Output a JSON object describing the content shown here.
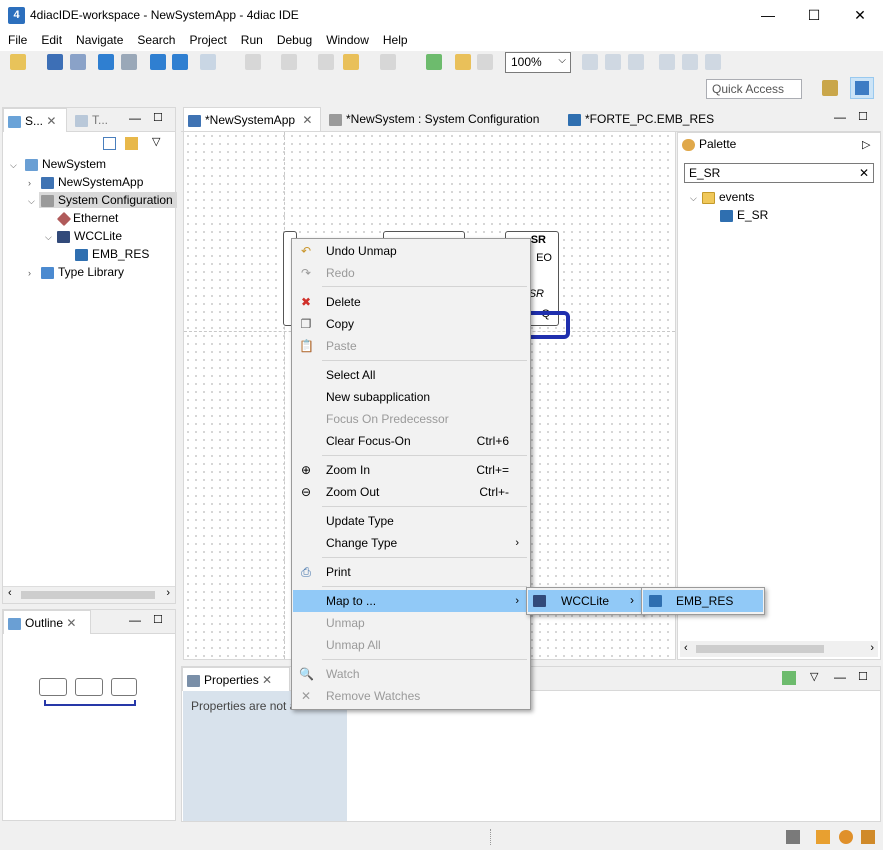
{
  "window": {
    "title": "4diacIDE-workspace - NewSystemApp - 4diac IDE",
    "minimize": "—",
    "maximize": "☐",
    "close": "✕"
  },
  "menu": [
    "File",
    "Edit",
    "Navigate",
    "Search",
    "Project",
    "Run",
    "Debug",
    "Window",
    "Help"
  ],
  "toolbar": {
    "zoom": "100%",
    "quick_access": "Quick Access"
  },
  "system_view": {
    "tabs": [
      "S...",
      "T..."
    ],
    "tree": [
      {
        "label": "NewSystem",
        "level": 0
      },
      {
        "label": "NewSystemApp",
        "level": 1
      },
      {
        "label": "System Configuration",
        "level": 1
      },
      {
        "label": "Ethernet",
        "level": 2
      },
      {
        "label": "WCCLite",
        "level": 2
      },
      {
        "label": "EMB_RES",
        "level": 3
      },
      {
        "label": "Type Library",
        "level": 1
      }
    ]
  },
  "outline": {
    "title": "Outline"
  },
  "editor": {
    "tabs": [
      "*NewSystemApp",
      "*NewSystem : System Configuration",
      "*FORTE_PC.EMB_RES"
    ],
    "fb_labels": {
      "title": "SR",
      "eo": "EO",
      "sr": "SR",
      "q": "Q"
    }
  },
  "palette": {
    "title": "Palette",
    "search": "E_SR",
    "clear": "✕",
    "folder": "events",
    "item": "E_SR"
  },
  "properties": {
    "title": "Properties",
    "text": "Properties are not a"
  },
  "context_menu": {
    "items": [
      {
        "label": "Undo Unmap",
        "icon": "undo-icon",
        "glyph": "↶",
        "enabled": true
      },
      {
        "label": "Redo",
        "icon": "redo-icon",
        "glyph": "↷",
        "enabled": false
      },
      {
        "label": "Delete",
        "icon": "delete-icon",
        "glyph": "✖",
        "enabled": true
      },
      {
        "label": "Copy",
        "icon": "copy-icon",
        "glyph": "❐",
        "enabled": true
      },
      {
        "label": "Paste",
        "icon": "paste-icon",
        "glyph": "📋",
        "enabled": false
      },
      {
        "label": "Select All",
        "enabled": true
      },
      {
        "label": "New subapplication",
        "enabled": true
      },
      {
        "label": "Focus On Predecessor",
        "enabled": false
      },
      {
        "label": "Clear Focus-On",
        "shortcut": "Ctrl+6",
        "enabled": true
      },
      {
        "label": "Zoom In",
        "shortcut": "Ctrl+=",
        "icon": "zoom-in-icon",
        "glyph": "⊕",
        "enabled": true
      },
      {
        "label": "Zoom Out",
        "shortcut": "Ctrl+-",
        "icon": "zoom-out-icon",
        "glyph": "⊖",
        "enabled": true
      },
      {
        "label": "Update Type",
        "enabled": true
      },
      {
        "label": "Change Type",
        "submenu": true,
        "enabled": true
      },
      {
        "label": "Print",
        "icon": "print-icon",
        "glyph": "⎙",
        "enabled": true
      },
      {
        "label": "Map to ...",
        "submenu": true,
        "highlighted": true,
        "enabled": true
      },
      {
        "label": "Unmap",
        "enabled": false
      },
      {
        "label": "Unmap All",
        "enabled": false
      },
      {
        "label": "Watch",
        "icon": "watch-icon",
        "glyph": "🔍",
        "enabled": false
      },
      {
        "label": "Remove Watches",
        "icon": "remove-watches-icon",
        "glyph": "✕",
        "enabled": false
      }
    ],
    "submenu_device": "WCCLite",
    "submenu_resource": "EMB_RES"
  }
}
